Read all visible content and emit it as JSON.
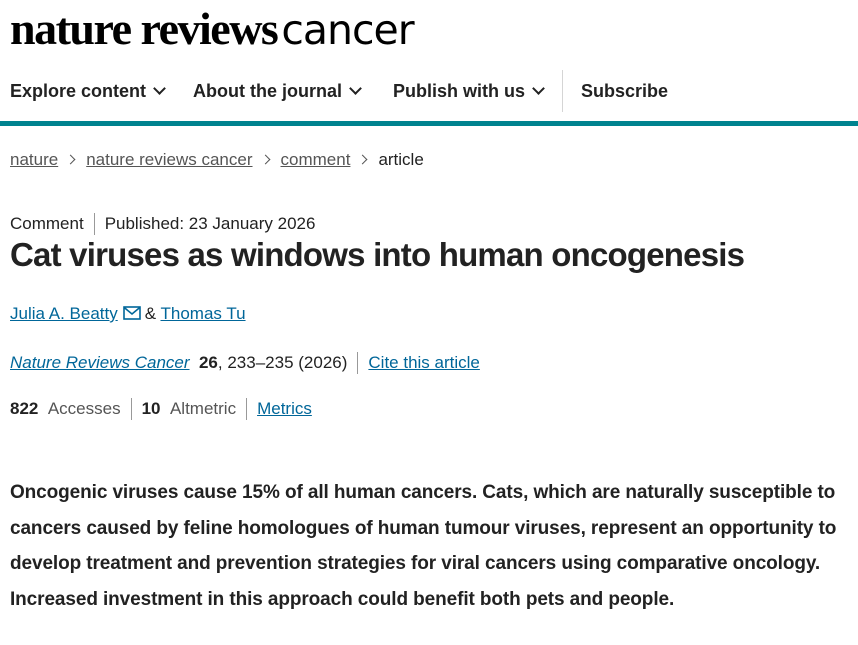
{
  "brand": {
    "bold": "nature reviews",
    "light": "cancer"
  },
  "nav": [
    {
      "label": "Explore content",
      "has_menu": true
    },
    {
      "label": "About the journal",
      "has_menu": true
    },
    {
      "label": "Publish with us",
      "has_menu": true
    },
    {
      "label": "Subscribe",
      "has_menu": false
    }
  ],
  "accent_color": "#00838f",
  "link_color": "#006699",
  "breadcrumb": {
    "items": [
      "nature",
      "nature reviews cancer",
      "comment"
    ],
    "current": "article"
  },
  "article": {
    "type": "Comment",
    "published": "Published: 23 January 2026",
    "title": "Cat viruses as windows into human oncogenesis",
    "authors": [
      "Julia A. Beatty",
      "Thomas Tu"
    ],
    "author_sep": "&",
    "journal": "Nature Reviews Cancer",
    "volume": "26",
    "pages_year": ", 233–235 (2026)",
    "cite_label": "Cite this article",
    "accesses_count": "822",
    "accesses_label": "Accesses",
    "altmetric_count": "10",
    "altmetric_label": "Altmetric",
    "metrics_label": "Metrics",
    "abstract": "Oncogenic viruses cause 15% of all human cancers. Cats, which are naturally susceptible to cancers caused by feline homologues of human tumour viruses, represent an opportunity to develop treatment and prevention strategies for viral cancers using comparative oncology. Increased investment in this approach could benefit both pets and people."
  }
}
